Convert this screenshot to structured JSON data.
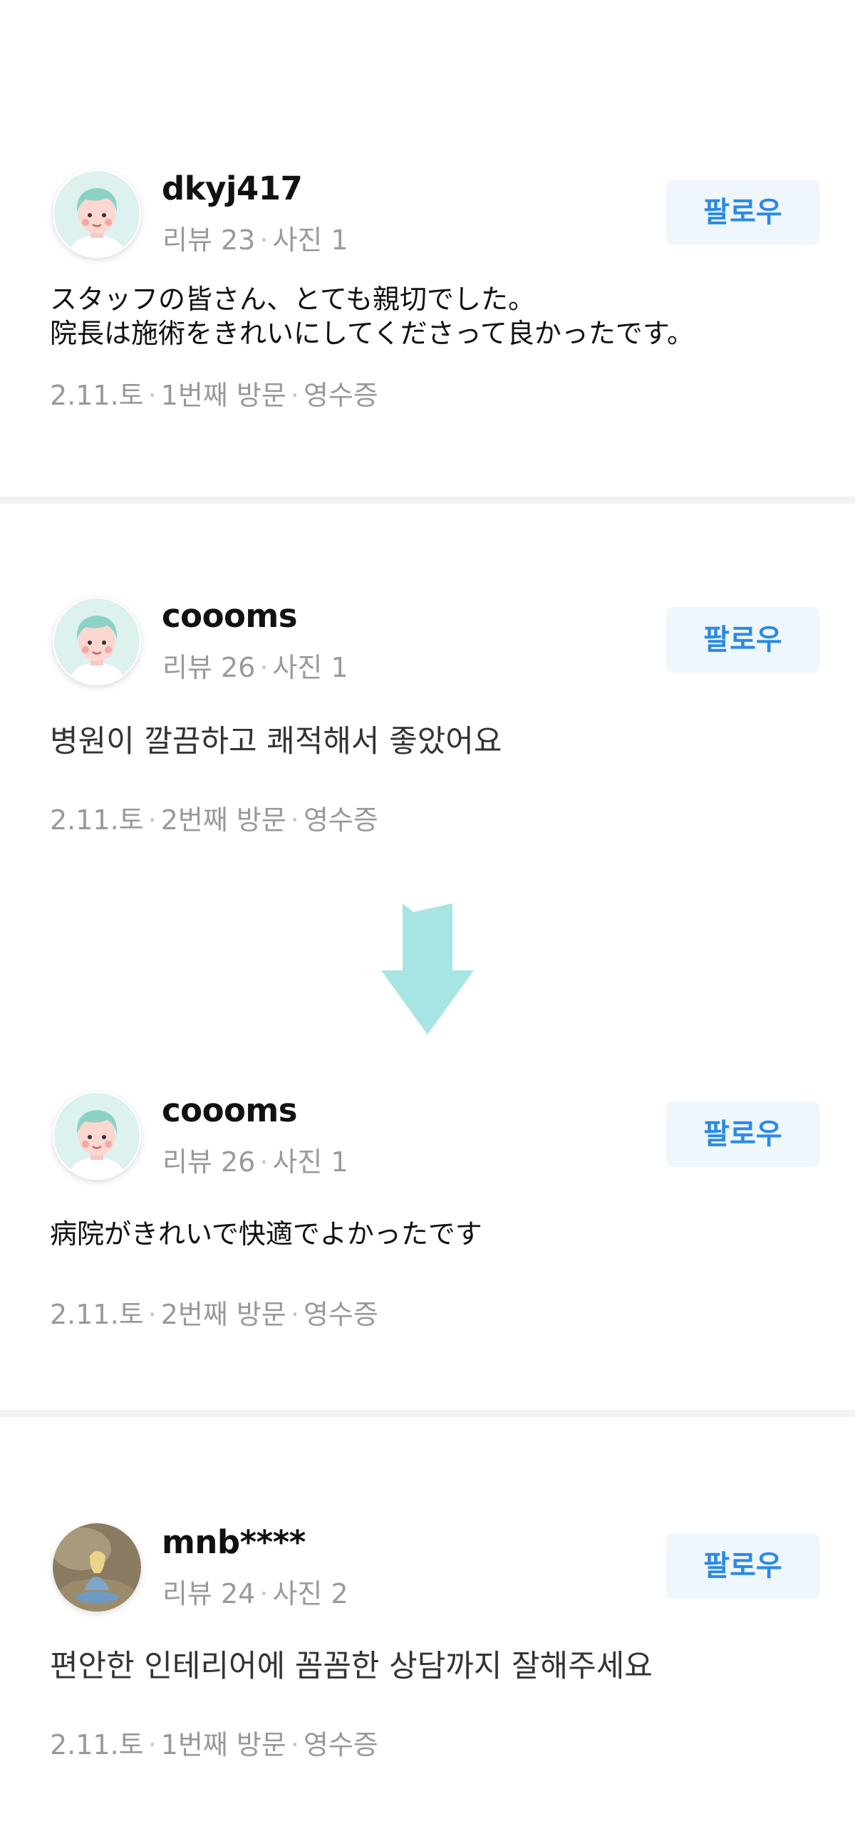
{
  "colors": {
    "follow_bg": "#eff6fc",
    "follow_text": "#2b8ae4",
    "arrow": "#a6e5e4",
    "meta_text": "#9a9a9a",
    "divider": "#f2f2f2"
  },
  "reviews": [
    {
      "username": "dkyj417",
      "stats": {
        "reviews": "리뷰 23",
        "photos": "사진 1"
      },
      "follow_label": "팔로우",
      "body_lines": [
        "スタッフの皆さん、とても親切でした。",
        "院長は施術をきれいにしてくださって良かったです。"
      ],
      "footer": {
        "date": "2.11.토",
        "visit": "1번째 방문",
        "proof": "영수증"
      },
      "avatar_icon": "cartoon-avatar-icon"
    },
    {
      "username": "coooms",
      "stats": {
        "reviews": "리뷰 26",
        "photos": "사진 1"
      },
      "follow_label": "팔로우",
      "body_lines": [
        "병원이 깔끔하고 쾌적해서 좋았어요"
      ],
      "footer": {
        "date": "2.11.토",
        "visit": "2번째 방문",
        "proof": "영수증"
      },
      "avatar_icon": "cartoon-avatar-icon"
    },
    {
      "username": "coooms",
      "stats": {
        "reviews": "리뷰 26",
        "photos": "사진 1"
      },
      "follow_label": "팔로우",
      "body_lines": [
        "病院がきれいで快適でよかったです"
      ],
      "footer": {
        "date": "2.11.토",
        "visit": "2번째 방문",
        "proof": "영수증"
      },
      "avatar_icon": "cartoon-avatar-icon"
    },
    {
      "username": "mnb****",
      "stats": {
        "reviews": "리뷰 24",
        "photos": "사진 2"
      },
      "follow_label": "팔로우",
      "body_lines": [
        "편안한 인테리어에 꼼꼼한 상담까지 잘해주세요"
      ],
      "footer": {
        "date": "2.11.토",
        "visit": "1번째 방문",
        "proof": "영수증"
      },
      "avatar_icon": "photo-avatar-icon"
    }
  ],
  "translation_arrow_icon": "down-arrow-icon"
}
